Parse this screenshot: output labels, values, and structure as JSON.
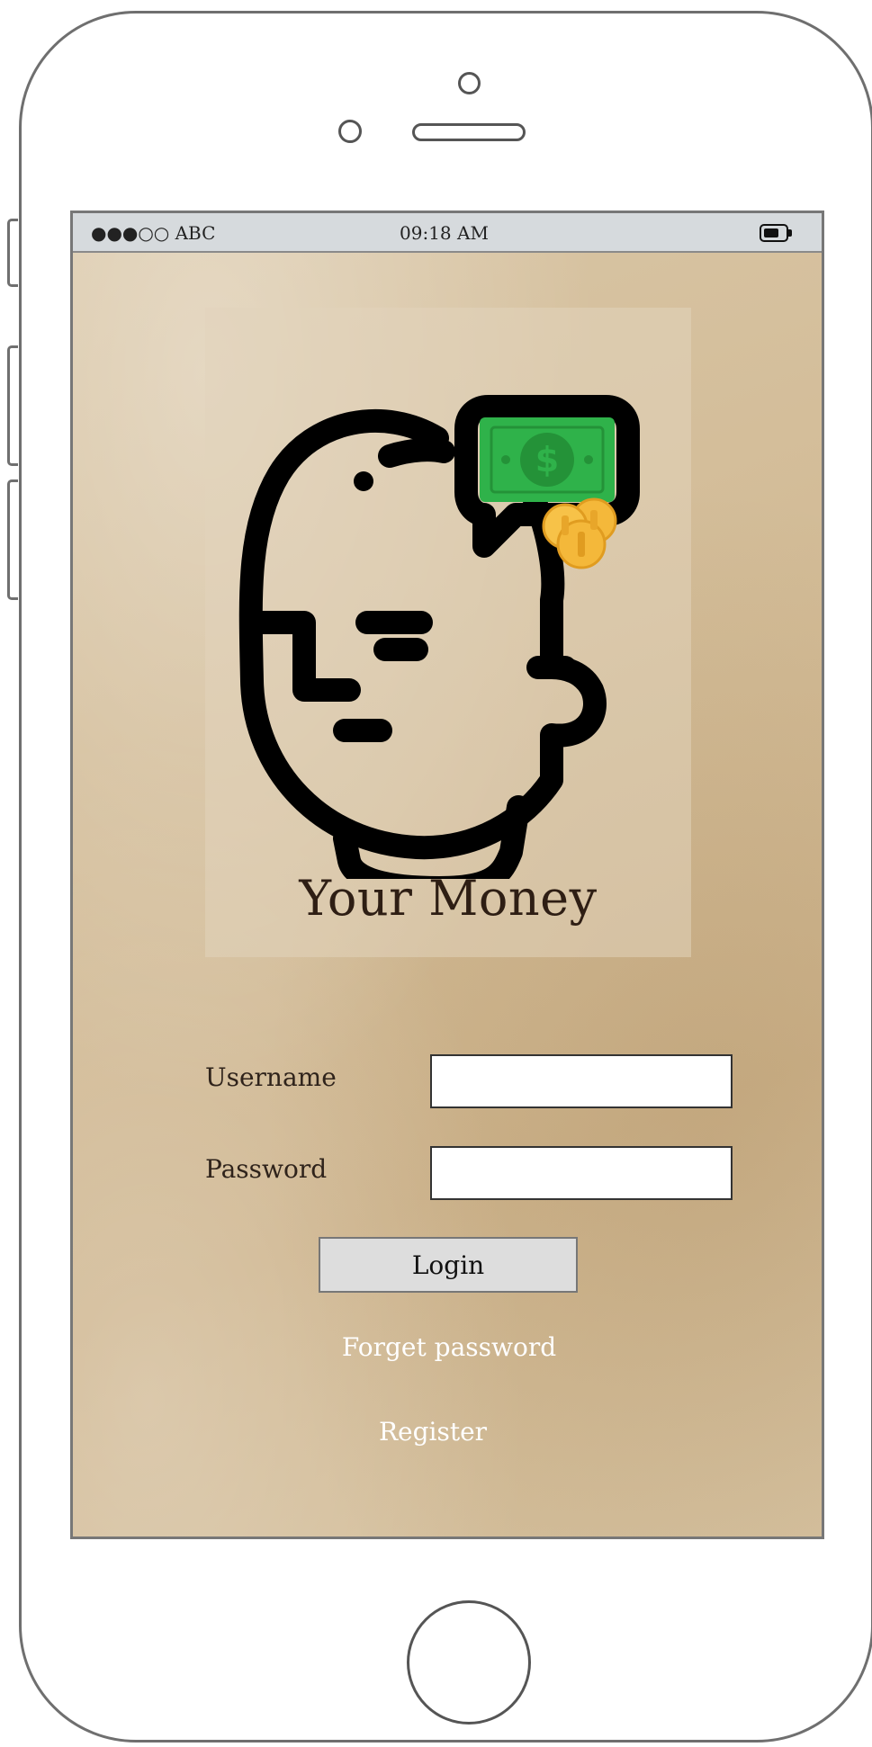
{
  "status_bar": {
    "carrier": "●●●○○ ABC",
    "time": "09:18 AM",
    "battery_icon": "battery-icon"
  },
  "logo": {
    "icon": "head-money-icon",
    "app_name": "Your Money",
    "colors": {
      "outline": "#000000",
      "bill": "#2fb24a",
      "coin": "#f4b83a"
    }
  },
  "login_form": {
    "username_label": "Username",
    "username_value": "",
    "password_label": "Password",
    "password_value": "",
    "login_label": "Login",
    "forgot_password_label": "Forget password",
    "register_label": "Register"
  }
}
